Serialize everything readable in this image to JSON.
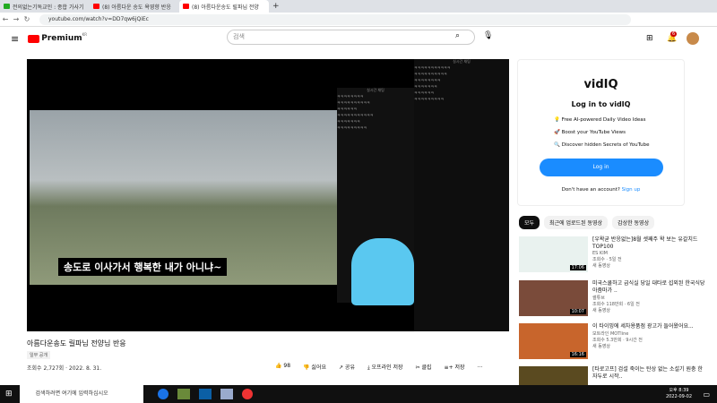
{
  "browser": {
    "tabs": [
      {
        "label": "전의없는기독교인 : 종합 가사기"
      },
      {
        "label": "(8) 아름다운 송도 욕영향 반응"
      },
      {
        "label": "(8) 아름다운송도 릴파님 전양"
      }
    ],
    "url": "youtube.com/watch?v=DD7qw6jQiEc"
  },
  "youtube": {
    "logo": "Premium",
    "region": "KR",
    "search_placeholder": "검색",
    "notif_count": "6"
  },
  "video": {
    "subtitle": "송도로 이사가서 행복한 내가 아니냐~",
    "title": "아름다운송도 릴파님 전양님 반응",
    "visibility": "일부 공개",
    "views": "조회수 2,727회 · 2022. 8. 31.",
    "likes": "98",
    "dislike": "싫어요",
    "share": "공유",
    "download": "오프라인 저장",
    "clip": "클립",
    "save": "저장",
    "more": "...",
    "chat_title": "실시간 채팅",
    "chat_lines": [
      "ㅋㅋㅋㅋㅋㅋㅋㅋ",
      "ㅋㅋㅋㅋㅋㅋㅋㅋㅋㅋ",
      "ㅋㅋㅋㅋㅋㅋ",
      "ㅋㅋㅋㅋㅋㅋㅋㅋㅋㅋㅋ",
      "ㅋㅋㅋㅋㅋㅋㅋ",
      "ㅋㅋㅋㅋㅋㅋㅋㅋㅋ"
    ]
  },
  "vidiq": {
    "logo": "vidIQ",
    "heading": "Log in to vidIQ",
    "features": [
      "Free AI-powered Daily Video Ideas",
      "Boost your YouTube Views",
      "Discover hidden Secrets of YouTube"
    ],
    "login": "Log in",
    "no_account": "Don't have an account?",
    "signup": "Sign up"
  },
  "chips": [
    "모두",
    "최근에 업로드된 동영상",
    "감상한 동영상"
  ],
  "recommended": [
    {
      "title": "[우왁굳 반응없는]8월 셋째주 왁 보는 유갈치드 TOP100",
      "channel": "ES KIM",
      "meta": "조회수 · 5일 전",
      "badge": "새 동영상",
      "duration": "17:06",
      "color": "#e9f2ef"
    },
    {
      "title": "미국스쿨하고 급식실 당일 대타로 섭외된 한국식당아줌마가 ..",
      "channel": "썰튜브",
      "meta": "조회수 118만회 · 6일 전",
      "badge": "새 동영상",
      "duration": "10:07",
      "color": "#7a4b3a"
    },
    {
      "title": "이 타이밍에 세차용품점 광고가 들어왔어요...",
      "channel": "모트라인 MOTline",
      "meta": "조회수 5.3만회 · 9시간 전",
      "badge": "새 동영상",
      "duration": "16:16",
      "color": "#c8652c"
    },
    {
      "title": "[타로고프] 검설 죽이는 탄상 없는 소설기 원충 한자두로 시작..",
      "channel": "",
      "meta": "",
      "badge": "",
      "duration": "",
      "color": "#5a4a20"
    }
  ],
  "taskbar": {
    "search_placeholder": "검색하려면 여기에 입력하십시오",
    "time": "오후 8:39",
    "date": "2022-09-02"
  }
}
